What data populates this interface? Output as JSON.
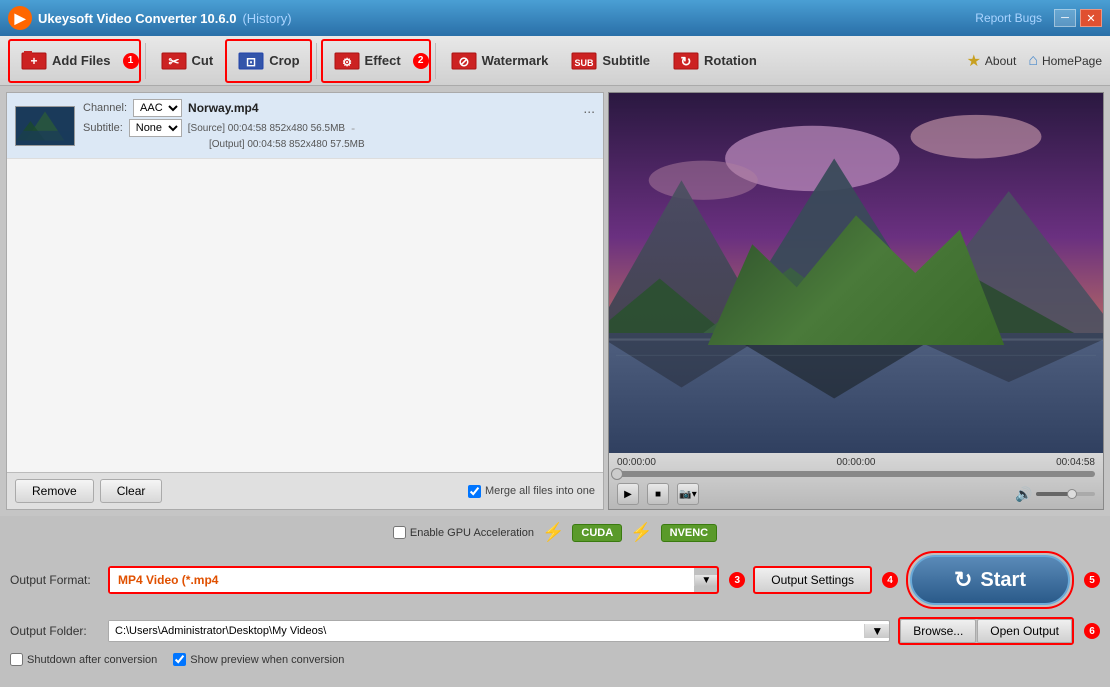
{
  "app": {
    "title": "Ukeysoft Video Converter 10.6.0",
    "history_label": "(History)",
    "report_bugs": "Report Bugs"
  },
  "toolbar": {
    "add_files": "Add Files",
    "cut": "Cut",
    "crop": "Crop",
    "effect": "Effect",
    "watermark": "Watermark",
    "subtitle": "Subtitle",
    "rotation": "Rotation",
    "about": "About",
    "homepage": "HomePage",
    "badge1": "1",
    "badge2": "2"
  },
  "file_list": {
    "channel_label": "Channel:",
    "subtitle_label": "Subtitle:",
    "channel_value": "AAC",
    "subtitle_value": "None",
    "filename": "Norway.mp4",
    "source_info": "[Source]  00:04:58  852x480  56.5MB",
    "output_info": "[Output]  00:04:58  852x480  57.5MB",
    "more": "...",
    "dash": "-"
  },
  "file_actions": {
    "remove": "Remove",
    "clear": "Clear",
    "merge_label": "Merge all files into one"
  },
  "preview": {
    "time_start": "00:00:00",
    "time_mid": "00:00:00",
    "time_end": "00:04:58"
  },
  "bottom": {
    "gpu_label": "Enable GPU Acceleration",
    "cuda": "CUDA",
    "nvenc": "NVENC",
    "format_label": "Output Format:",
    "format_value": "MP4 Video (*.mp4",
    "badge3": "3",
    "output_settings": "Output Settings",
    "badge4": "4",
    "folder_label": "Output Folder:",
    "folder_path": "C:\\Users\\Administrator\\Desktop\\My Videos\\",
    "browse": "Browse...",
    "open_output": "Open Output",
    "badge6": "6",
    "shutdown": "Shutdown after conversion",
    "show_preview": "Show preview when conversion",
    "start": "Start",
    "badge5": "5"
  }
}
